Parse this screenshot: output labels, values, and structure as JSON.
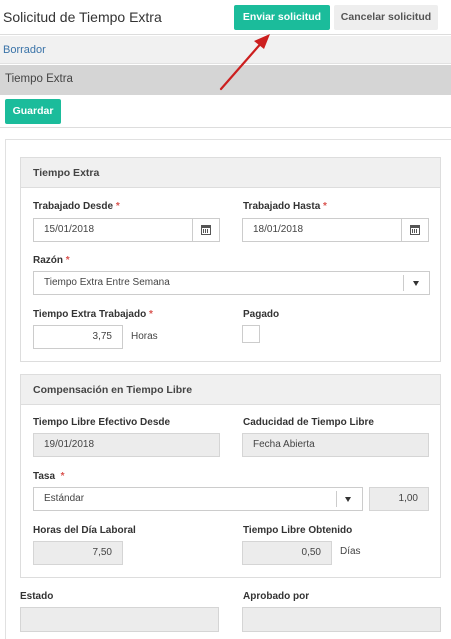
{
  "header": {
    "title": "Solicitud de Tiempo Extra",
    "send_label": "Enviar solicitud",
    "cancel_label": "Cancelar solicitud"
  },
  "status": {
    "label": "Borrador"
  },
  "section": {
    "title": "Tiempo Extra"
  },
  "toolbar": {
    "save_label": "Guardar"
  },
  "overtime": {
    "title": "Tiempo Extra",
    "worked_from_label": "Trabajado Desde",
    "worked_from_value": "15/01/2018",
    "worked_to_label": "Trabajado Hasta",
    "worked_to_value": "18/01/2018",
    "reason_label": "Razón",
    "reason_value": "Tiempo Extra Entre Semana",
    "hours_worked_label": "Tiempo Extra Trabajado",
    "hours_worked_value": "3,75",
    "hours_unit": "Horas",
    "paid_label": "Pagado",
    "required_mark": "*"
  },
  "compensation": {
    "title": "Compensación en Tiempo Libre",
    "effective_from_label": "Tiempo Libre Efectivo Desde",
    "effective_from_value": "19/01/2018",
    "expiry_label": "Caducidad de Tiempo Libre",
    "expiry_value": "Fecha Abierta",
    "rate_label": "Tasa",
    "rate_value": "Estándar",
    "rate_factor": "1,00",
    "workday_hours_label": "Horas del Día Laboral",
    "workday_hours_value": "7,50",
    "obtained_label": "Tiempo Libre Obtenido",
    "obtained_value": "0,50",
    "obtained_unit": "Días"
  },
  "footer": {
    "state_label": "Estado",
    "approved_by_label": "Aprobado por"
  },
  "colors": {
    "accent": "#1bbc9b",
    "link": "#3a73a8",
    "required": "#d9534f",
    "annotation_arrow": "#cc1f1f"
  }
}
